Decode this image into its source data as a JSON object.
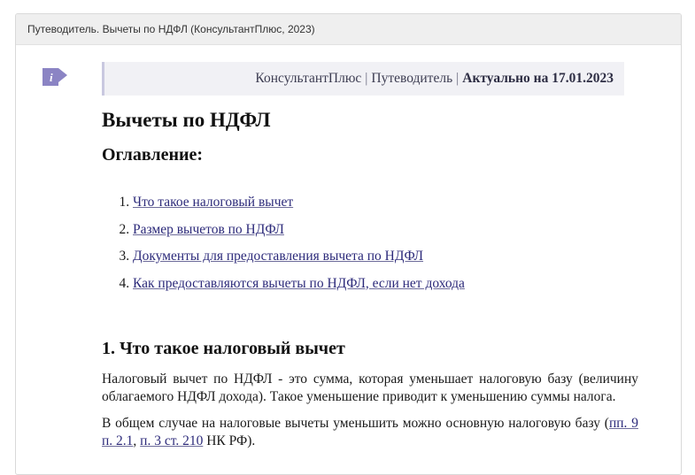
{
  "window": {
    "title": "Путеводитель. Вычеты по НДФЛ (КонсультантПлюс, 2023)"
  },
  "header": {
    "source": "КонсультантПлюс",
    "separator": "|",
    "section": "Путеводитель",
    "actual_label": "Актуально на 17.01.2023"
  },
  "icons": {
    "info": "info-icon"
  },
  "colors": {
    "icon_purple": "#8b84c4",
    "link": "#2c2a7a",
    "header_bg": "#f1f1f5"
  },
  "document": {
    "title": "Вычеты по НДФЛ",
    "toc_title": "Оглавление:",
    "toc": [
      "Что такое налоговый вычет",
      "Размер вычетов по НДФЛ",
      "Документы для предоставления вычета по НДФЛ",
      "Как предоставляются вычеты по НДФЛ, если нет дохода"
    ],
    "section1": {
      "title": "1. Что такое налоговый вычет",
      "p1": "Налоговый вычет по НДФЛ - это сумма, которая уменьшает налоговую базу (величину облагаемого НДФЛ дохода). Такое уменьшение приводит к уменьшению суммы налога.",
      "p2_start": "В общем случае на налоговые вычеты уменьшить можно основную налоговую базу (",
      "p2_link1": "пп. 9 п. 2.1",
      "p2_sep": ", ",
      "p2_link2": "п. 3 ст. 210",
      "p2_end": " НК РФ)."
    }
  }
}
